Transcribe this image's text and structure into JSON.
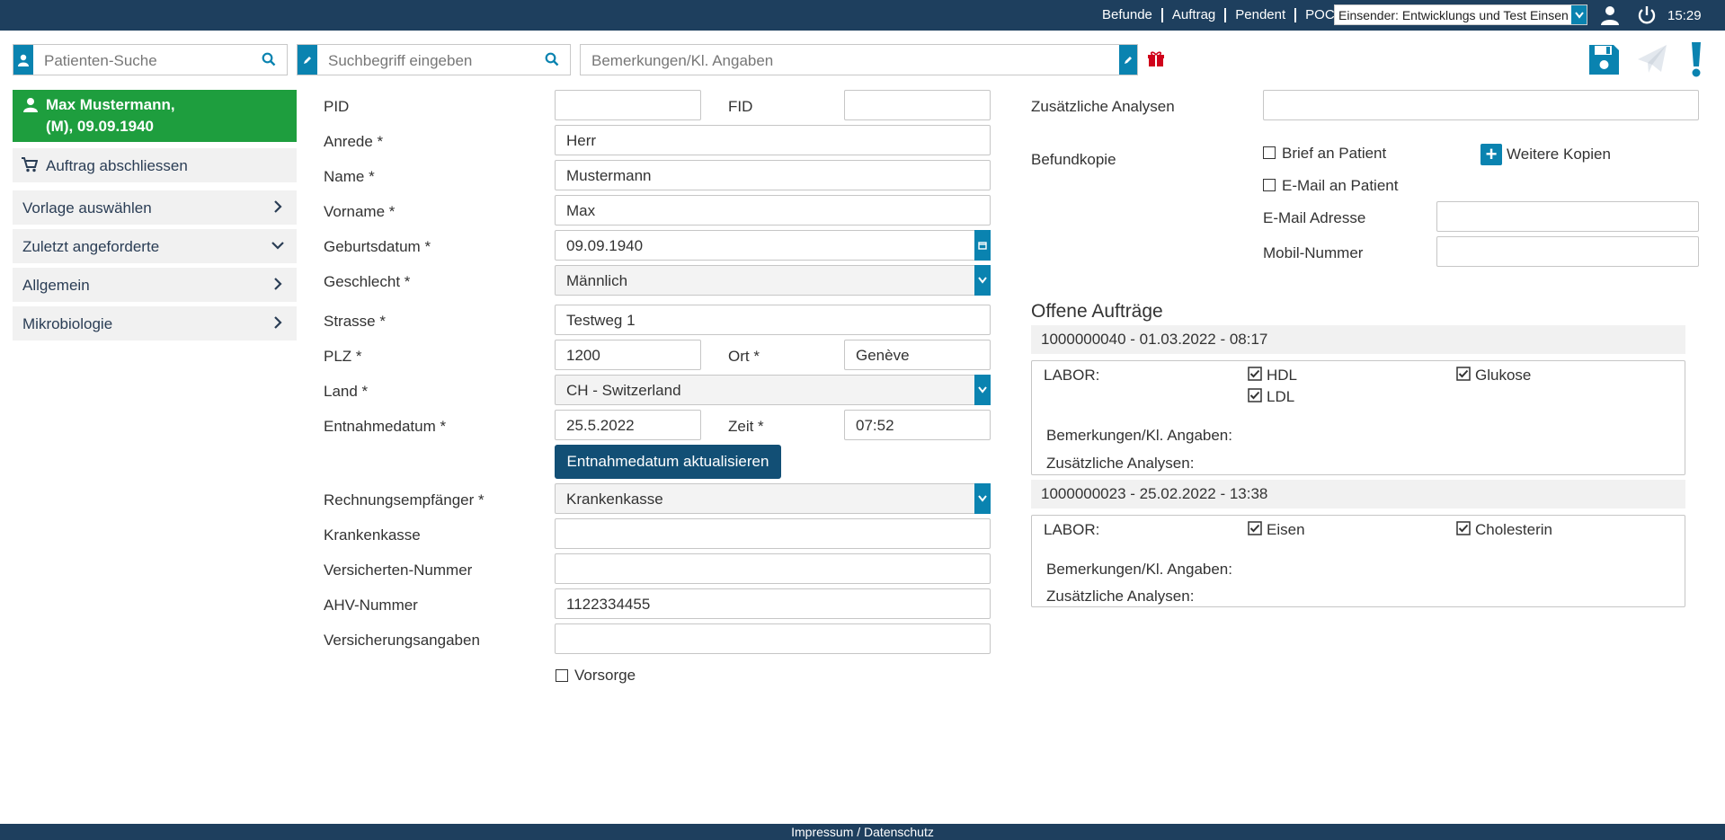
{
  "topbar": {
    "nav": [
      "Befunde",
      "Auftrag",
      "Pendent",
      "POCT"
    ],
    "sender": "Einsender: Entwicklungs und Test Einsender",
    "time": "15:29"
  },
  "search": {
    "patient_placeholder": "Patienten-Suche",
    "term_placeholder": "Suchbegriff eingeben",
    "remarks_placeholder": "Bemerkungen/Kl. Angaben"
  },
  "patient": {
    "line1": "Max Mustermann,",
    "line2": "(M), 09.09.1940"
  },
  "sidebar": {
    "items": [
      {
        "label": "Auftrag abschliessen"
      },
      {
        "label": "Vorlage auswählen"
      },
      {
        "label": "Zuletzt angeforderte"
      },
      {
        "label": "Allgemein"
      },
      {
        "label": "Mikrobiologie"
      }
    ]
  },
  "form": {
    "pid_label": "PID",
    "pid": "",
    "fid_label": "FID",
    "fid": "",
    "anrede_label": "Anrede *",
    "anrede": "Herr",
    "name_label": "Name *",
    "name": "Mustermann",
    "vorname_label": "Vorname *",
    "vorname": "Max",
    "geburtsdatum_label": "Geburtsdatum *",
    "geburtsdatum": "09.09.1940",
    "geschlecht_label": "Geschlecht *",
    "geschlecht": "Männlich",
    "strasse_label": "Strasse *",
    "strasse": "Testweg 1",
    "plz_label": "PLZ *",
    "plz": "1200",
    "ort_label": "Ort *",
    "ort": "Genève",
    "land_label": "Land *",
    "land": "CH - Switzerland",
    "entnahmedatum_label": "Entnahmedatum *",
    "entnahmedatum": "25.5.2022",
    "zeit_label": "Zeit *",
    "zeit": "07:52",
    "update_button": "Entnahmedatum aktualisieren",
    "rechnung_label": "Rechnungsempfänger *",
    "rechnung": "Krankenkasse",
    "krankenkasse_label": "Krankenkasse",
    "krankenkasse": "",
    "versicherten_label": "Versicherten-Nummer",
    "versicherten": "",
    "ahv_label": "AHV-Nummer",
    "ahv": "1122334455",
    "versicherungsangaben_label": "Versicherungsangaben",
    "versicherungsangaben": "",
    "vorsorge_label": "Vorsorge"
  },
  "right": {
    "zusatz_label": "Zusätzliche Analysen",
    "zusatz": "",
    "befundkopie_label": "Befundkopie",
    "brief_label": "Brief an Patient",
    "email_patient_label": "E-Mail an Patient",
    "weitere_label": "Weitere Kopien",
    "email_adresse_label": "E-Mail Adresse",
    "email_adresse": "",
    "mobil_label": "Mobil-Nummer",
    "mobil": ""
  },
  "orders": {
    "title": "Offene Aufträge",
    "list": [
      {
        "header": "1000000040 - 01.03.2022 - 08:17",
        "labor": "LABOR:",
        "tests": [
          "HDL",
          "Glukose",
          "LDL"
        ],
        "remarks": "Bemerkungen/Kl. Angaben:",
        "extra": "Zusätzliche Analysen:"
      },
      {
        "header": "1000000023 - 25.02.2022 - 13:38",
        "labor": "LABOR:",
        "tests": [
          "Eisen",
          "Cholesterin"
        ],
        "remarks": "Bemerkungen/Kl. Angaben:",
        "extra": "Zusätzliche Analysen:"
      }
    ]
  },
  "footer": {
    "text": "Impressum / Datenschutz"
  },
  "colors": {
    "header": "#1e3f5e",
    "accent": "#0a83b0",
    "patient": "#1e9e3e",
    "warning": "#d0021b"
  },
  "icons": [
    "user-icon",
    "power-icon",
    "search-icon",
    "pen-icon",
    "gift-icon",
    "save-icon",
    "send-icon",
    "exclamation-icon",
    "cart-icon",
    "chevron-right-icon",
    "chevron-down-icon",
    "calendar-icon",
    "checkbox-icon",
    "plus-icon"
  ]
}
